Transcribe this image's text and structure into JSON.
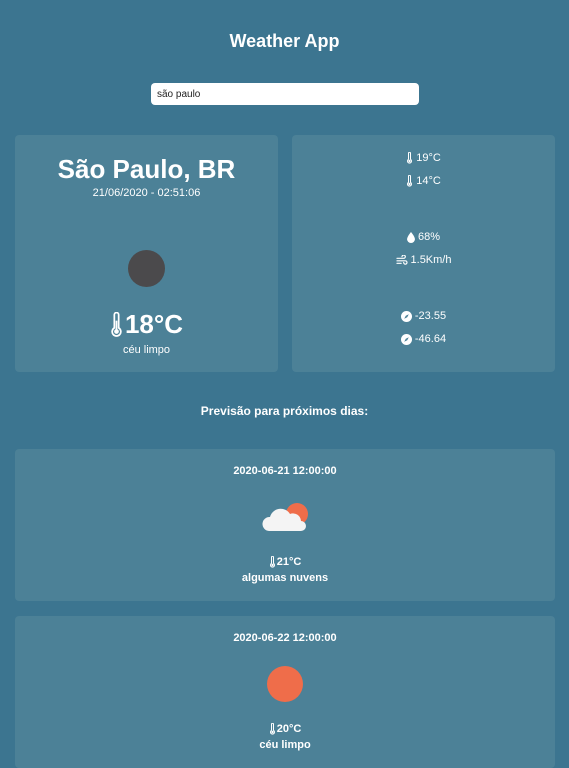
{
  "app": {
    "title": "Weather App"
  },
  "search": {
    "value": "são paulo",
    "placeholder": ""
  },
  "current": {
    "city": "São Paulo, BR",
    "datetime": "21/06/2020 - 02:51:06",
    "temp": "18°C",
    "description": "céu limpo",
    "icon": "placeholder-circle-icon"
  },
  "details": {
    "temp_max": "19°C",
    "temp_min": "14°C",
    "humidity": "68%",
    "wind": "1.5Km/h",
    "lat": "-23.55",
    "lon": "-46.64"
  },
  "forecast": {
    "heading": "Previsão para próximos dias:",
    "items": [
      {
        "date": "2020-06-21 12:00:00",
        "temp": "21°C",
        "description": "algumas nuvens",
        "icon": "partly-cloudy-icon"
      },
      {
        "date": "2020-06-22 12:00:00",
        "temp": "20°C",
        "description": "céu limpo",
        "icon": "sun-icon"
      }
    ]
  },
  "colors": {
    "background": "#3c7590",
    "card": "#4c8197",
    "sun": "#ef6d4a",
    "cloud": "#f4f4f4",
    "placeholder": "#4b4a4c"
  }
}
